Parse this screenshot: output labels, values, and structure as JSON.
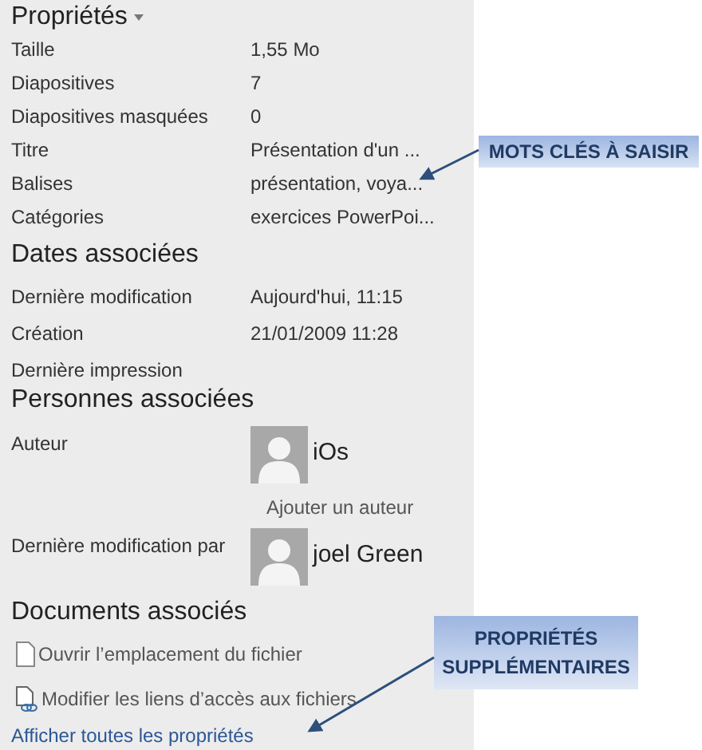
{
  "properties": {
    "title": "Propriétés",
    "rows": [
      {
        "label": "Taille",
        "value": "1,55 Mo"
      },
      {
        "label": "Diapositives",
        "value": "7"
      },
      {
        "label": "Diapositives masquées",
        "value": "0"
      },
      {
        "label": "Titre",
        "value": "Présentation d'un ..."
      },
      {
        "label": "Balises",
        "value": "présentation, voya..."
      },
      {
        "label": "Catégories",
        "value": "exercices PowerPoi..."
      }
    ]
  },
  "dates": {
    "heading": "Dates associées",
    "rows": [
      {
        "label": "Dernière modification",
        "value": "Aujourd'hui, 11:15"
      },
      {
        "label": "Création",
        "value": "21/01/2009 11:28"
      },
      {
        "label": "Dernière impression"
      }
    ]
  },
  "people": {
    "heading": "Personnes associées",
    "rows": [
      {
        "label": "Auteur",
        "name": "iOs",
        "add_link": "Ajouter un auteur"
      },
      {
        "label": "Dernière modification par",
        "name": "joel Green"
      }
    ]
  },
  "documents": {
    "heading": "Documents associés",
    "actions": [
      {
        "kind": "file",
        "label": "Ouvrir l’emplacement du fichier"
      },
      {
        "kind": "link",
        "label": "Modifier les liens d’accès aux fichiers"
      }
    ],
    "show_all": "Afficher toutes les propriétés"
  },
  "callouts": [
    {
      "text": "MOTS CLÉS À SAISIR"
    },
    {
      "text": "PROPRIÉTÉS SUPPLÉMENTAIRES"
    }
  ]
}
